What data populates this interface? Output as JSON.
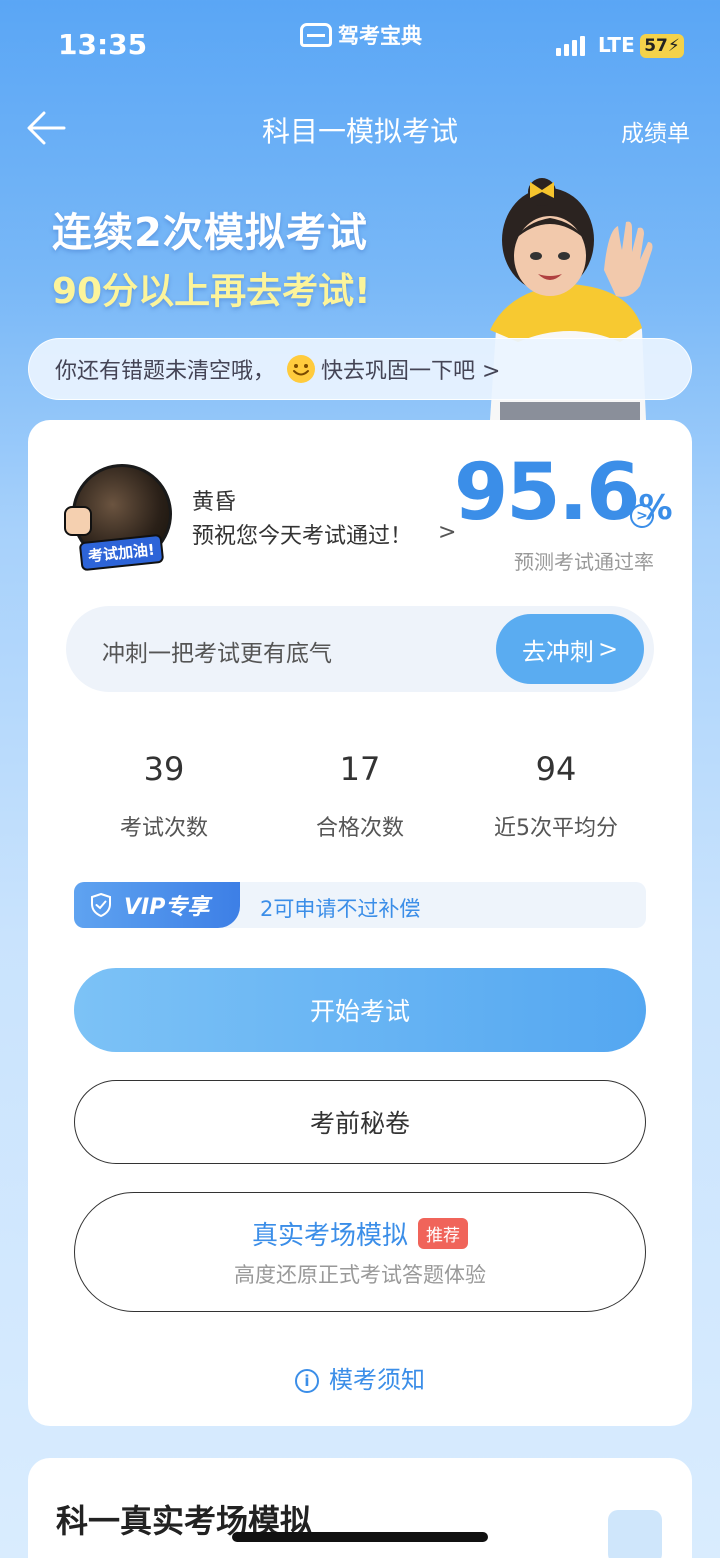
{
  "status_bar": {
    "time": "13:35",
    "carrier_name": "驾考宝典",
    "network": "LTE",
    "battery": "57"
  },
  "nav": {
    "title": "科目一模拟考试",
    "right_link": "成绩单"
  },
  "banner": {
    "line1": "连续2次模拟考试",
    "line2": "90分以上再去考试!"
  },
  "notice": {
    "text_before": "你还有错题未清空哦，",
    "text_after": "快去巩固一下吧 >"
  },
  "profile": {
    "avatar_badge": "考试加油!",
    "name": "黄昏",
    "wish": "预祝您今天考试通过！",
    "pass_rate_value": "95.6",
    "pass_rate_unit": "%",
    "pass_rate_label": "预测考试通过率"
  },
  "sprint": {
    "text": "冲刺一把考试更有底气",
    "button": "去冲刺"
  },
  "stats": [
    {
      "value": "39",
      "label": "考试次数"
    },
    {
      "value": "17",
      "label": "合格次数"
    },
    {
      "value": "94",
      "label": "近5次平均分"
    }
  ],
  "vip": {
    "tag": "VIP专享",
    "text": "2可申请不过补偿"
  },
  "buttons": {
    "start": "开始考试",
    "secret": "考前秘卷",
    "real_title": "真实考场模拟",
    "real_badge": "推荐",
    "real_sub": "高度还原正式考试答题体验"
  },
  "notes": "模考须知",
  "section2": {
    "title": "科一真实考场模拟"
  },
  "colors": {
    "accent": "#3b8ee8",
    "button_blue": "#5aacf1",
    "badge_red": "#f0645a",
    "banner_yellow": "#fcf49b"
  }
}
